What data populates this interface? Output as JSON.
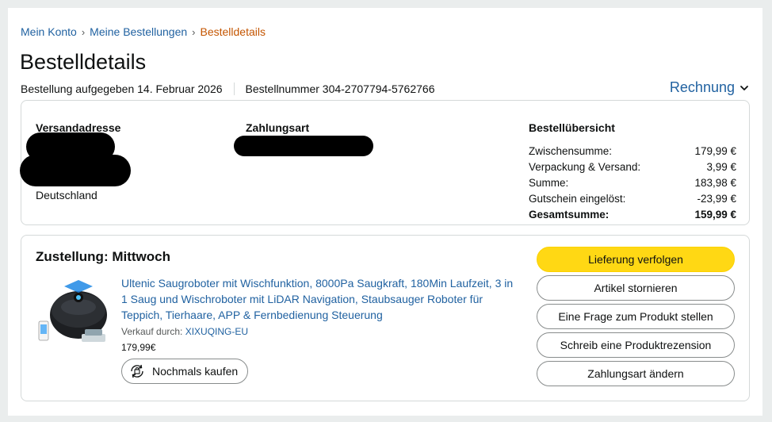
{
  "breadcrumb": {
    "items": [
      "Mein Konto",
      "Meine Bestellungen",
      "Bestelldetails"
    ],
    "separator": "›"
  },
  "page_title": "Bestelldetails",
  "order_meta": {
    "placed": "Bestellung aufgegeben 14. Februar 2026",
    "number": "Bestellnummer 304-2707794-5762766"
  },
  "invoice_label": "Rechnung",
  "shipping": {
    "heading": "Versandadresse",
    "country": "Deutschland"
  },
  "payment": {
    "heading": "Zahlungsart"
  },
  "summary": {
    "heading": "Bestellübersicht",
    "rows": [
      {
        "label": "Zwischensumme:",
        "value": "179,99 €"
      },
      {
        "label": "Verpackung & Versand:",
        "value": "3,99 €"
      },
      {
        "label": "Summe:",
        "value": "183,98 €"
      },
      {
        "label": "Gutschein eingelöst:",
        "value": "-23,99 €"
      },
      {
        "label": "Gesamtsumme:",
        "value": "159,99 €"
      }
    ]
  },
  "delivery": {
    "heading": "Zustellung: Mittwoch",
    "product_title": "Ultenic Saugroboter mit Wischfunktion, 8000Pa Saugkraft, 180Min Laufzeit, 3 in 1 Saug und Wischroboter mit LiDAR Navigation, Staubsauger Roboter für Teppich, Tierhaare, APP & Fernbedienung Steuerung",
    "seller_prefix": "Verkauf durch: ",
    "seller_name": "XIXUQING-EU",
    "price": "179,99€",
    "rebuy_label": "Nochmals kaufen"
  },
  "actions": [
    "Lieferung verfolgen",
    "Artikel stornieren",
    "Eine Frage zum Produkt stellen",
    "Schreib eine Produktrezension",
    "Zahlungsart ändern"
  ],
  "colors": {
    "link": "#2162a1",
    "current_crumb": "#c45500",
    "primary_button": "#ffd814",
    "background": "#eaeded"
  },
  "icons": {
    "invoice_dropdown": "chevron-down-icon",
    "rebuy": "rebuy-icon"
  }
}
